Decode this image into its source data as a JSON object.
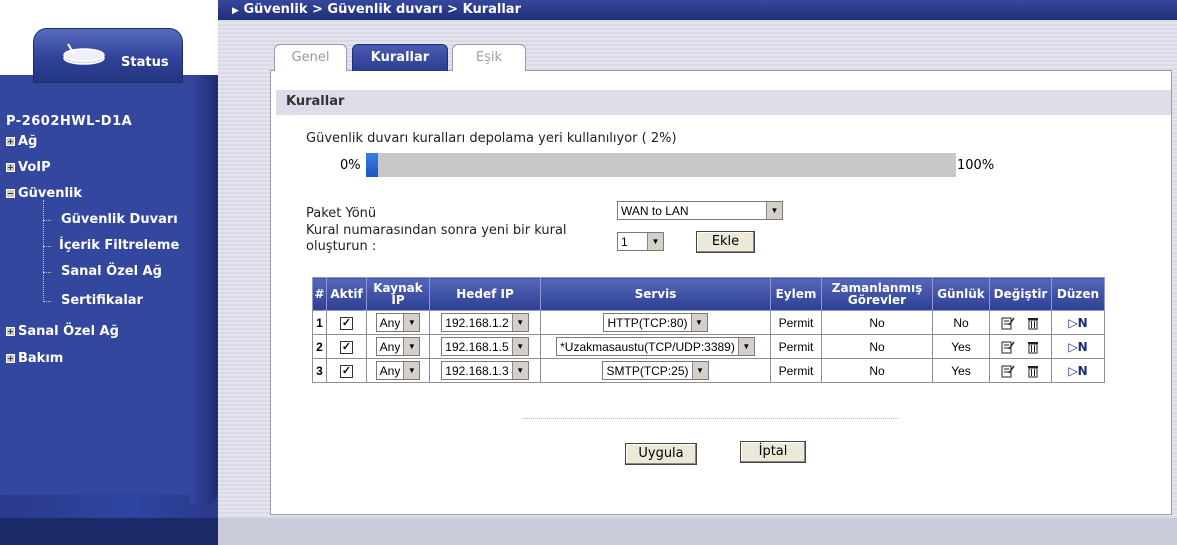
{
  "breadcrumb": "Güvenlik > Güvenlik duvarı > Kurallar",
  "sidebar": {
    "status_label": "Status",
    "device_name": "P-2602HWL-D1A",
    "items": [
      {
        "label": "Ağ"
      },
      {
        "label": "VoIP"
      },
      {
        "label": "Güvenlik"
      },
      {
        "label": "Sanal Özel Ağ"
      },
      {
        "label": "Bakım"
      }
    ],
    "subitems": [
      {
        "label": "Güvenlik Duvarı"
      },
      {
        "label": "İçerik Filtreleme"
      },
      {
        "label": "Sanal Özel Ağ"
      },
      {
        "label": "Sertifikalar"
      }
    ]
  },
  "tabs": [
    {
      "label": "Genel"
    },
    {
      "label": "Kurallar"
    },
    {
      "label": "Eşik"
    }
  ],
  "section_title": "Kurallar",
  "usage": {
    "text": "Güvenlik duvarı kuralları depolama yeri kullanılıyor ( 2%)",
    "min": "0%",
    "max": "100%",
    "percent": 2
  },
  "form": {
    "packet_direction_label": "Paket Yönü",
    "packet_direction_value": "WAN to LAN",
    "rule_number_label_1": "Kural numarasından sonra yeni bir kural",
    "rule_number_label_2": "oluşturun :",
    "rule_number_value": "1",
    "add_button": "Ekle"
  },
  "table": {
    "headers": {
      "num": "#",
      "active": "Aktif",
      "source_1": "Kaynak",
      "source_2": "IP",
      "dest": "Hedef IP",
      "service": "Servis",
      "action": "Eylem",
      "sched_1": "Zamanlanmış",
      "sched_2": "Görevler",
      "log": "Günlük",
      "modify": "Değiştir",
      "order": "Düzen"
    },
    "rows": [
      {
        "num": "1",
        "source": "Any",
        "dest": "192.168.1.2",
        "service": "HTTP(TCP:80)",
        "action": "Permit",
        "schedule": "No",
        "log": "No"
      },
      {
        "num": "2",
        "source": "Any",
        "dest": "192.168.1.5",
        "service": "*Uzakmasaustu(TCP/UDP:3389)",
        "action": "Permit",
        "schedule": "No",
        "log": "Yes"
      },
      {
        "num": "3",
        "source": "Any",
        "dest": "192.168.1.3",
        "service": "SMTP(TCP:25)",
        "action": "Permit",
        "schedule": "No",
        "log": "Yes"
      }
    ],
    "move_label": "N"
  },
  "buttons": {
    "apply": "Uygula",
    "cancel": "İptal"
  },
  "colors": {
    "navy": "#2f44a0",
    "accent_blue": "#1d54c2"
  }
}
